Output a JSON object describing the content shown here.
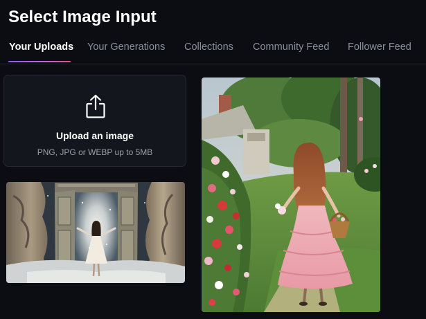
{
  "header": {
    "title": "Select Image Input"
  },
  "tabs": [
    {
      "label": "Your Uploads",
      "active": true
    },
    {
      "label": "Your Generations",
      "active": false
    },
    {
      "label": "Collections",
      "active": false
    },
    {
      "label": "Community Feed",
      "active": false
    },
    {
      "label": "Follower Feed",
      "active": false
    }
  ],
  "upload": {
    "icon": "share-upload-icon",
    "title": "Upload an image",
    "subtitle": "PNG, JPG or WEBP up to 5MB"
  },
  "gallery": [
    {
      "name": "girl-at-open-door-painting"
    },
    {
      "name": "girl-in-pink-dress-garden-painting"
    }
  ],
  "colors": {
    "background": "#0c0d12",
    "card": "#14161d",
    "accent_start": "#8a5cf6",
    "accent_end": "#e0507e",
    "tab_inactive": "#8b8f9c"
  }
}
